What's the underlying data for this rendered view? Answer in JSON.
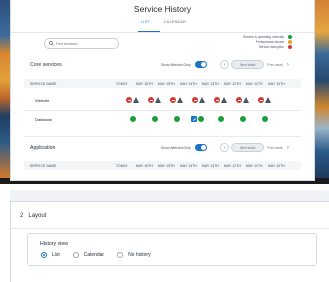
{
  "colors": {
    "accent": "#1a73c8",
    "ok": "#1e9e3a",
    "performance": "#e0a320",
    "disruption": "#d93830"
  },
  "header": {
    "title": "Service History"
  },
  "tabs": [
    {
      "label": "LIST",
      "active": true
    },
    {
      "label": "CALENDAR",
      "active": false
    }
  ],
  "search": {
    "placeholder": "Find services..."
  },
  "legend": [
    {
      "label": "Service is operating normally",
      "color": "#1e9e3a"
    },
    {
      "label": "Performance issues",
      "color": "#e0a320"
    },
    {
      "label": "Service disruption",
      "color": "#d93830"
    }
  ],
  "core": {
    "title": "Core services",
    "toggle_label": "Show Affected Only",
    "pager": {
      "next": "Next week",
      "prev": "Prev week"
    },
    "columns": [
      "SERVICE NAME",
      "TODAY",
      "MAY 16TH",
      "MAY 15TH",
      "MAY 14TH",
      "MAY 13TH",
      "MAY 12TH",
      "MAY 11TH",
      "MAY 10TH"
    ],
    "rows": [
      {
        "name": "Website",
        "status": [
          "",
          "red-warn",
          "red-warn",
          "red-warn",
          "red-warn",
          "red-warn",
          "red-warn",
          "red-warn"
        ]
      },
      {
        "name": "Database",
        "status": [
          "",
          "green",
          "green",
          "green",
          "blue-green",
          "green",
          "green",
          "green"
        ]
      }
    ]
  },
  "application": {
    "title": "Application",
    "toggle_label": "Show Affected Only",
    "pager": {
      "next": "Next week",
      "prev": "Prev week"
    },
    "columns": [
      "SERVICE NAME",
      "TODAY",
      "MAY 16TH",
      "MAY 15TH",
      "MAY 14TH",
      "MAY 13TH",
      "MAY 12TH",
      "MAY 11TH",
      "MAY 10TH"
    ]
  },
  "layout_section": {
    "number": "2",
    "title": "Layout",
    "history_view_label": "History view",
    "options": [
      {
        "label": "List",
        "selected": true
      },
      {
        "label": "Calendar",
        "selected": false
      },
      {
        "label": "No history",
        "selected": false
      }
    ]
  }
}
